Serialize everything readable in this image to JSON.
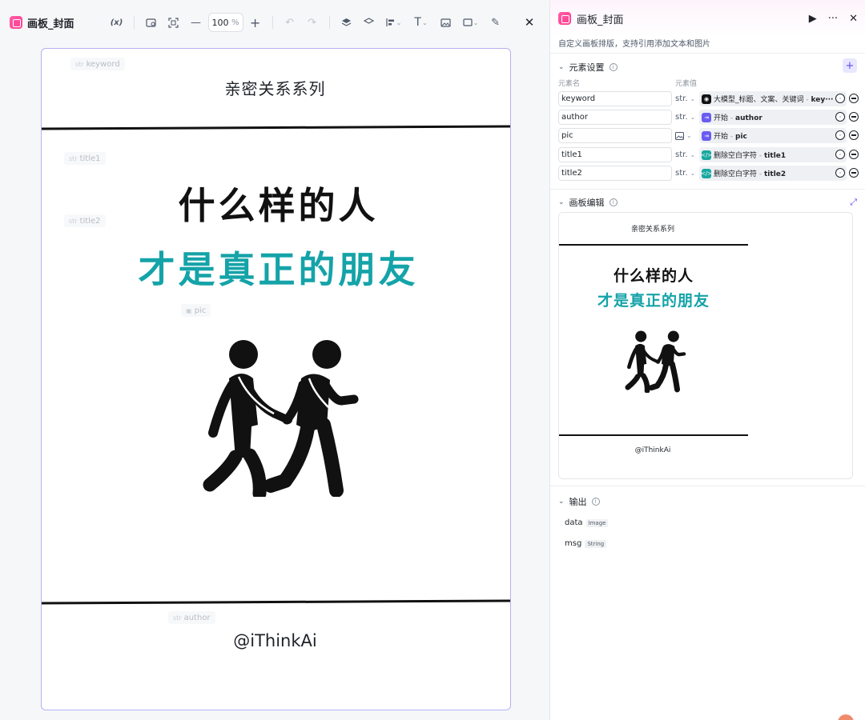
{
  "editor": {
    "title": "画板_封面",
    "var_label": "(x)",
    "zoom_value": "100",
    "zoom_unit": "%"
  },
  "canvas": {
    "placeholders": {
      "keyword": "keyword",
      "title1": "title1",
      "title2": "title2",
      "pic": "pic",
      "author": "author"
    },
    "keyword": "亲密关系系列",
    "title1": "什么样的人",
    "title2": "才是真正的朋友",
    "author": "@iThinkAi"
  },
  "panel": {
    "title": "画板_封面",
    "description": "自定义画板排版，支持引用添加文本和图片",
    "elements_section": "元素设置",
    "col_name": "元素名",
    "col_value": "元素值",
    "rows": [
      {
        "name": "keyword",
        "type": "str.",
        "source": "大模型_标题、文案、关键词",
        "var": "key···"
      },
      {
        "name": "author",
        "type": "str.",
        "source": "开始",
        "var": "author"
      },
      {
        "name": "pic",
        "type": "img",
        "source": "开始",
        "var": "pic"
      },
      {
        "name": "title1",
        "type": "str.",
        "source": "删除空白字符",
        "var": "title1"
      },
      {
        "name": "title2",
        "type": "str.",
        "source": "删除空白字符",
        "var": "title2"
      }
    ],
    "canvas_section": "画板编辑",
    "output_section": "输出",
    "outputs": [
      {
        "name": "data",
        "type": "Image"
      },
      {
        "name": "msg",
        "type": "String"
      }
    ]
  },
  "colors": {
    "accent": "#5b4cf0",
    "teal_title": "#14a3a8",
    "canvas_border": "#b7b0f0"
  }
}
